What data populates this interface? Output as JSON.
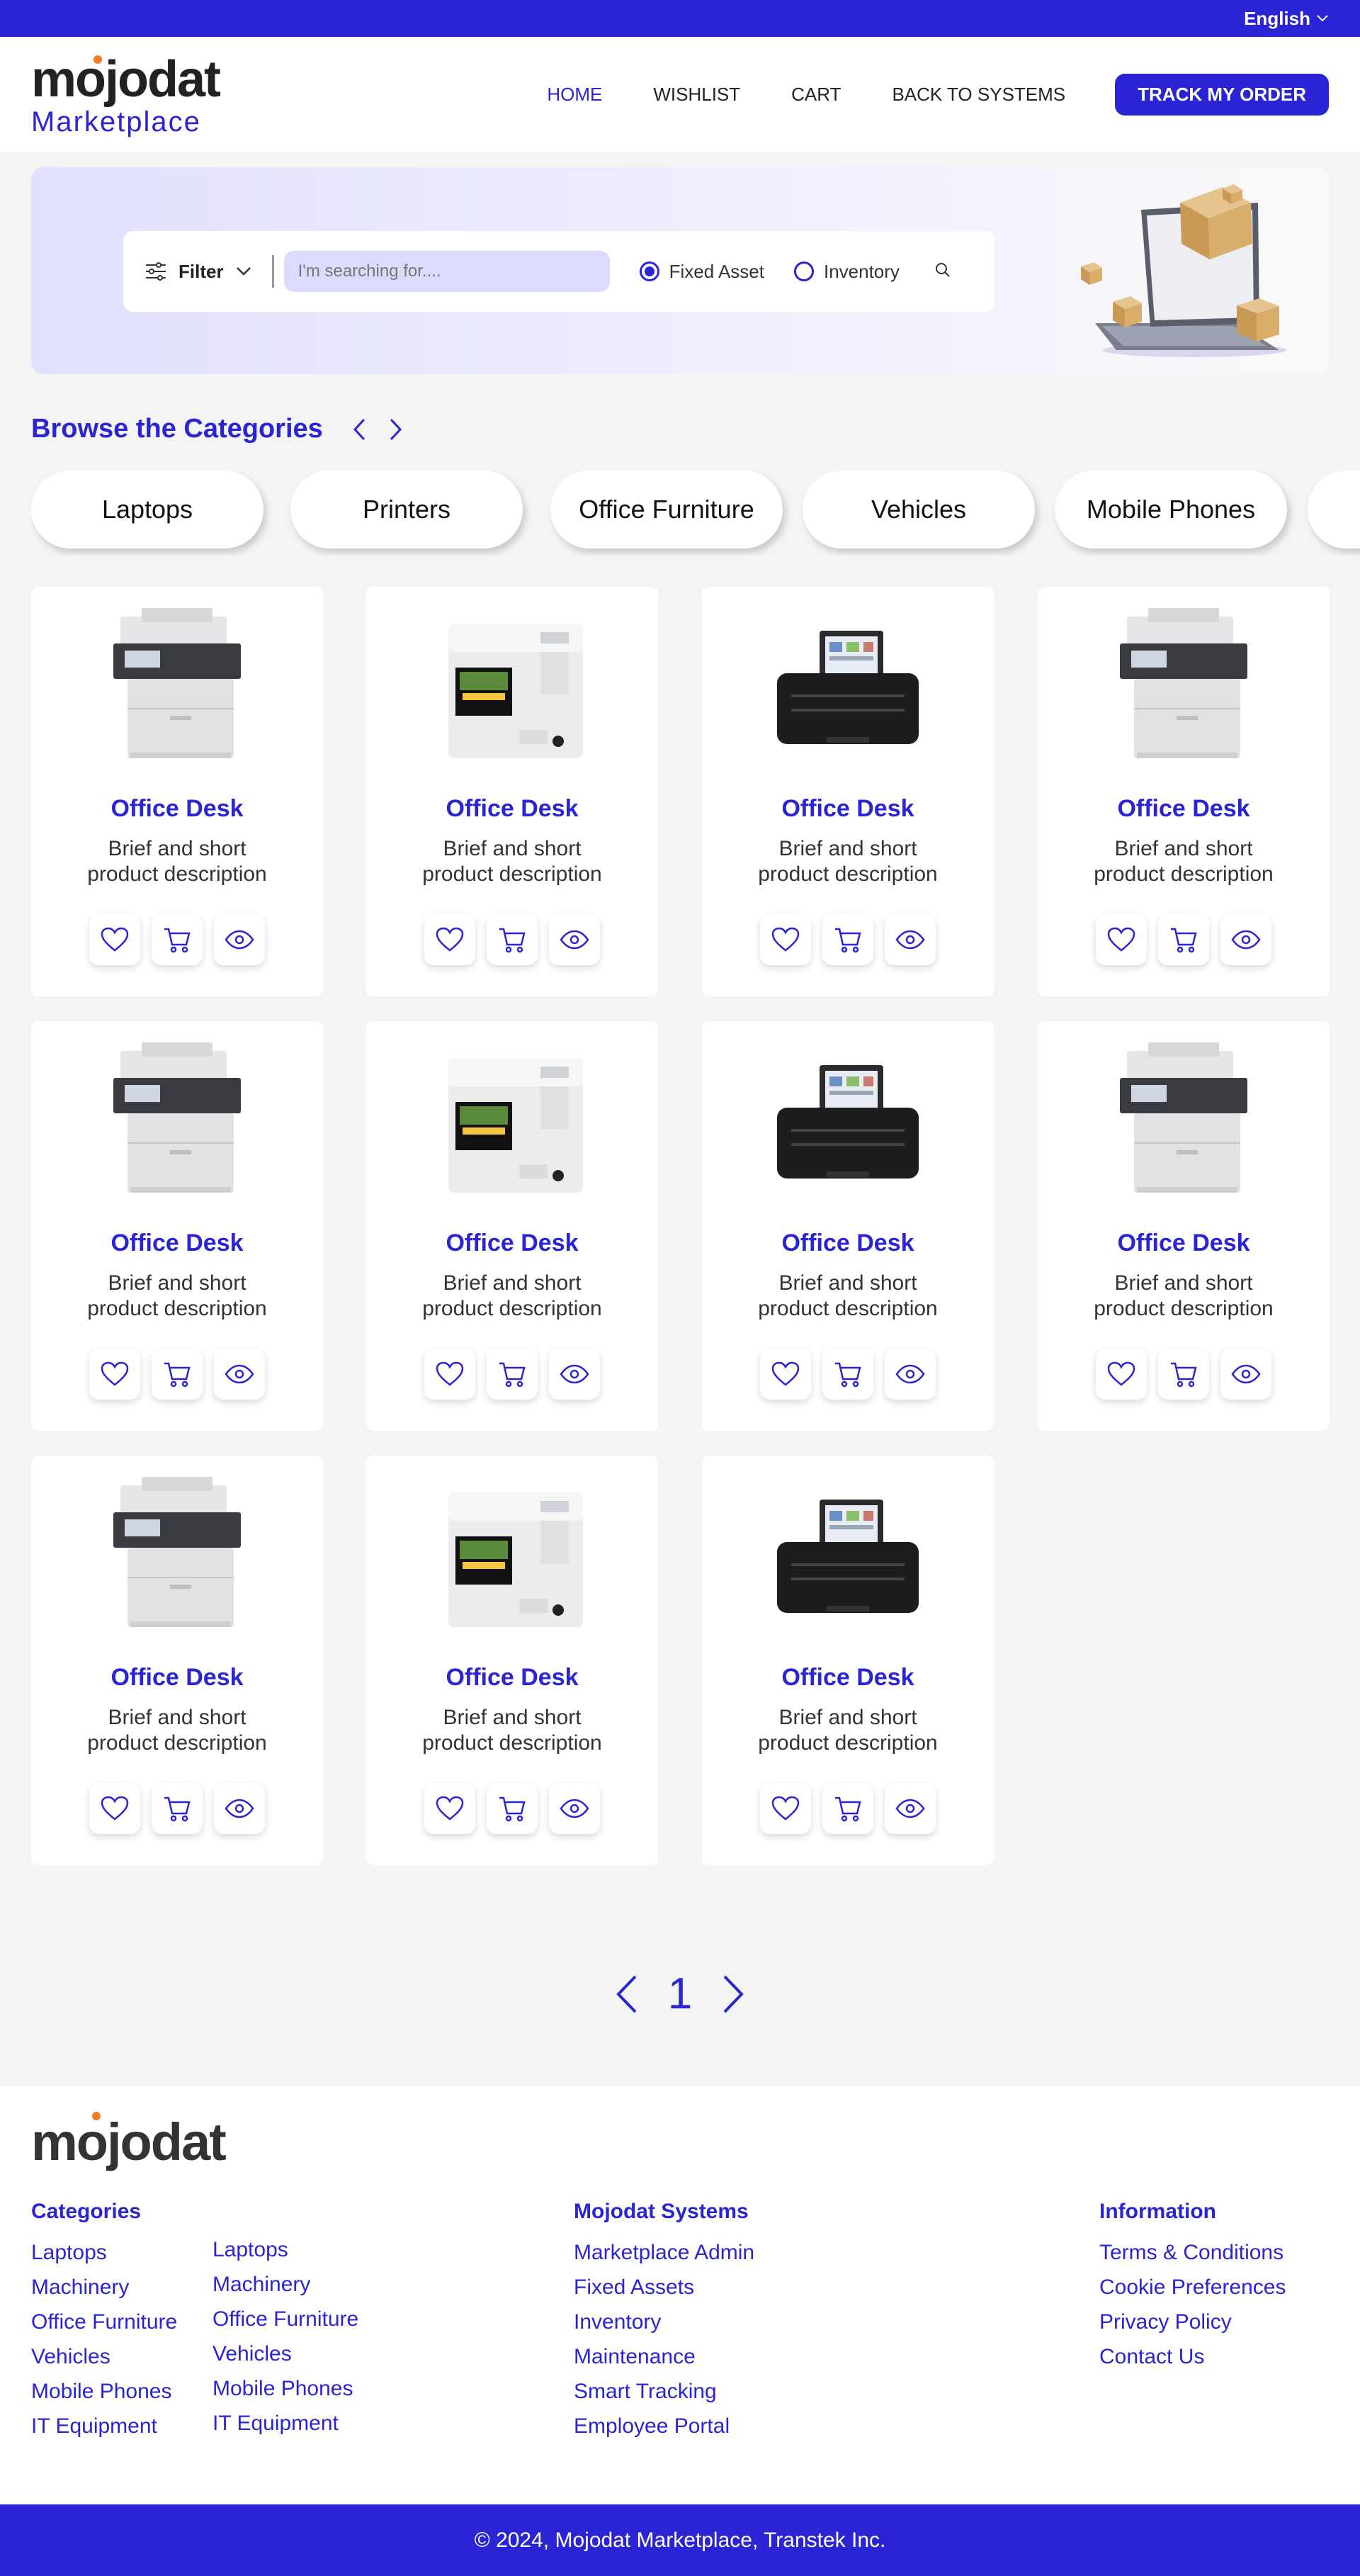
{
  "topbar": {
    "language": "English"
  },
  "header": {
    "logo_brand": "mojodat",
    "logo_sub": "Marketplace",
    "nav": [
      "HOME",
      "WISHLIST",
      "CART",
      "BACK TO SYSTEMS"
    ],
    "track_label": "TRACK MY ORDER"
  },
  "search": {
    "filter_label": "Filter",
    "placeholder": "I'm searching for....",
    "option_fixed": "Fixed Asset",
    "option_inventory": "Inventory",
    "selected": "Fixed Asset"
  },
  "categories": {
    "title": "Browse the Categories",
    "items": [
      "Laptops",
      "Printers",
      "Office Furniture",
      "Vehicles",
      "Mobile Phones"
    ]
  },
  "products": [
    {
      "name": "Office Desk",
      "desc": "Brief and short product description",
      "image": "printer-laser"
    },
    {
      "name": "Office Desk",
      "desc": "Brief and short product description",
      "image": "printer-label"
    },
    {
      "name": "Office Desk",
      "desc": "Brief and short product description",
      "image": "printer-photo"
    },
    {
      "name": "Office Desk",
      "desc": "Brief and short product description",
      "image": "printer-laser"
    },
    {
      "name": "Office Desk",
      "desc": "Brief and short product description",
      "image": "printer-laser"
    },
    {
      "name": "Office Desk",
      "desc": "Brief and short product description",
      "image": "printer-label"
    },
    {
      "name": "Office Desk",
      "desc": "Brief and short product description",
      "image": "printer-photo"
    },
    {
      "name": "Office Desk",
      "desc": "Brief and short product description",
      "image": "printer-laser"
    },
    {
      "name": "Office Desk",
      "desc": "Brief and short product description",
      "image": "printer-laser"
    },
    {
      "name": "Office Desk",
      "desc": "Brief and short product description",
      "image": "printer-label"
    },
    {
      "name": "Office Desk",
      "desc": "Brief and short product description",
      "image": "printer-photo"
    }
  ],
  "pagination": {
    "current": "1"
  },
  "footer": {
    "logo": "mojodat",
    "categories_title": "Categories",
    "categories_col1": [
      "Laptops",
      "Machinery",
      "Office Furniture",
      "Vehicles",
      "Mobile Phones",
      "IT Equipment"
    ],
    "categories_col2": [
      "Laptops",
      "Machinery",
      "Office Furniture",
      "Vehicles",
      "Mobile Phones",
      "IT Equipment"
    ],
    "systems_title": "Mojodat Systems",
    "systems": [
      "Marketplace Admin",
      "Fixed Assets",
      "Inventory",
      "Maintenance",
      "Smart Tracking",
      "Employee Portal"
    ],
    "info_title": "Information",
    "info": [
      "Terms & Conditions",
      "Cookie Preferences",
      "Privacy Policy",
      "Contact Us"
    ],
    "copyright": "© 2024, Mojodat Marketplace, Transtek Inc."
  },
  "colors": {
    "primary": "#2b24d4",
    "accent": "#f27a2b",
    "background": "#f4f4f4"
  }
}
